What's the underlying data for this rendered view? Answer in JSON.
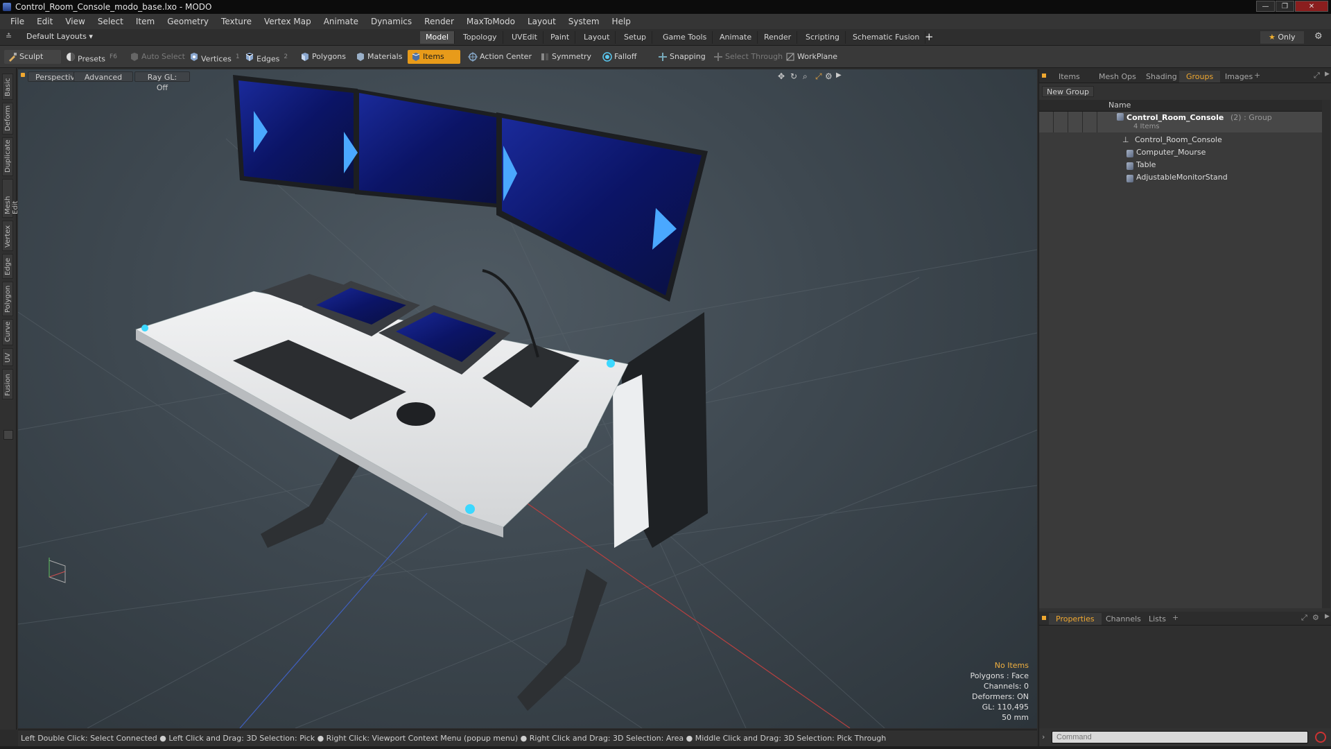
{
  "window": {
    "title": "Control_Room_Console_modo_base.lxo - MODO",
    "controls": [
      "—",
      "❐",
      "✕"
    ]
  },
  "menu": [
    "File",
    "Edit",
    "View",
    "Select",
    "Item",
    "Geometry",
    "Texture",
    "Vertex Map",
    "Animate",
    "Dynamics",
    "Render",
    "MaxToModo",
    "Layout",
    "System",
    "Help"
  ],
  "layoutbar": {
    "layouts_label": "Default Layouts",
    "tabs": [
      "Model",
      "Topology",
      "UVEdit",
      "Paint",
      "Layout",
      "Setup",
      "Game Tools",
      "Animate",
      "Render",
      "Scripting",
      "Schematic Fusion"
    ],
    "active_tab": "Model",
    "add": "+",
    "only_label": "Only",
    "gear": "⚙"
  },
  "toolbar": {
    "sculpt": "Sculpt",
    "presets": "Presets",
    "presets_key": "F6",
    "auto_select": "Auto Select",
    "vertices": "Vertices",
    "vertices_key": "1",
    "edges": "Edges",
    "edges_key": "2",
    "polygons": "Polygons",
    "materials": "Materials",
    "items": "Items",
    "action_center": "Action Center",
    "symmetry": "Symmetry",
    "falloff": "Falloff",
    "snapping": "Snapping",
    "select_through": "Select Through",
    "workplane": "WorkPlane",
    "accent": "#e89b1a"
  },
  "left_tabs": [
    "Basic",
    "Deform",
    "Duplicate",
    "Mesh Edit",
    "Vertex",
    "Edge",
    "Polygon",
    "Curve",
    "UV",
    "Fusion"
  ],
  "viewport": {
    "view": "Perspective",
    "mode": "Advanced",
    "raygl": "Ray GL: Off",
    "info": {
      "selection": "No Items",
      "polygons": "Polygons : Face",
      "channels": "Channels: 0",
      "deformers": "Deformers: ON",
      "gl": "GL: 110,495",
      "scale": "50 mm"
    }
  },
  "status": "Left Double Click: Select Connected ● Left Click and Drag: 3D Selection: Pick ● Right Click: Viewport Context Menu (popup menu) ● Right Click and Drag: 3D Selection: Area ● Middle Click and Drag: 3D Selection: Pick Through",
  "right_panel": {
    "tabs": [
      "Items",
      "Mesh Ops",
      "Shading",
      "Groups",
      "Images"
    ],
    "active_tab": "Groups",
    "new_group": "New Group",
    "col_name": "Name",
    "group": {
      "name": "Control_Room_Console",
      "count": "(2)",
      "type": ": Group",
      "sub": "4 Items"
    },
    "items": [
      "Control_Room_Console",
      "Computer_Mourse",
      "Table",
      "AdjustableMonitorStand"
    ],
    "bottom_tabs": [
      "Properties",
      "Channels",
      "Lists"
    ],
    "bottom_active": "Properties",
    "command_placeholder": "Command"
  }
}
